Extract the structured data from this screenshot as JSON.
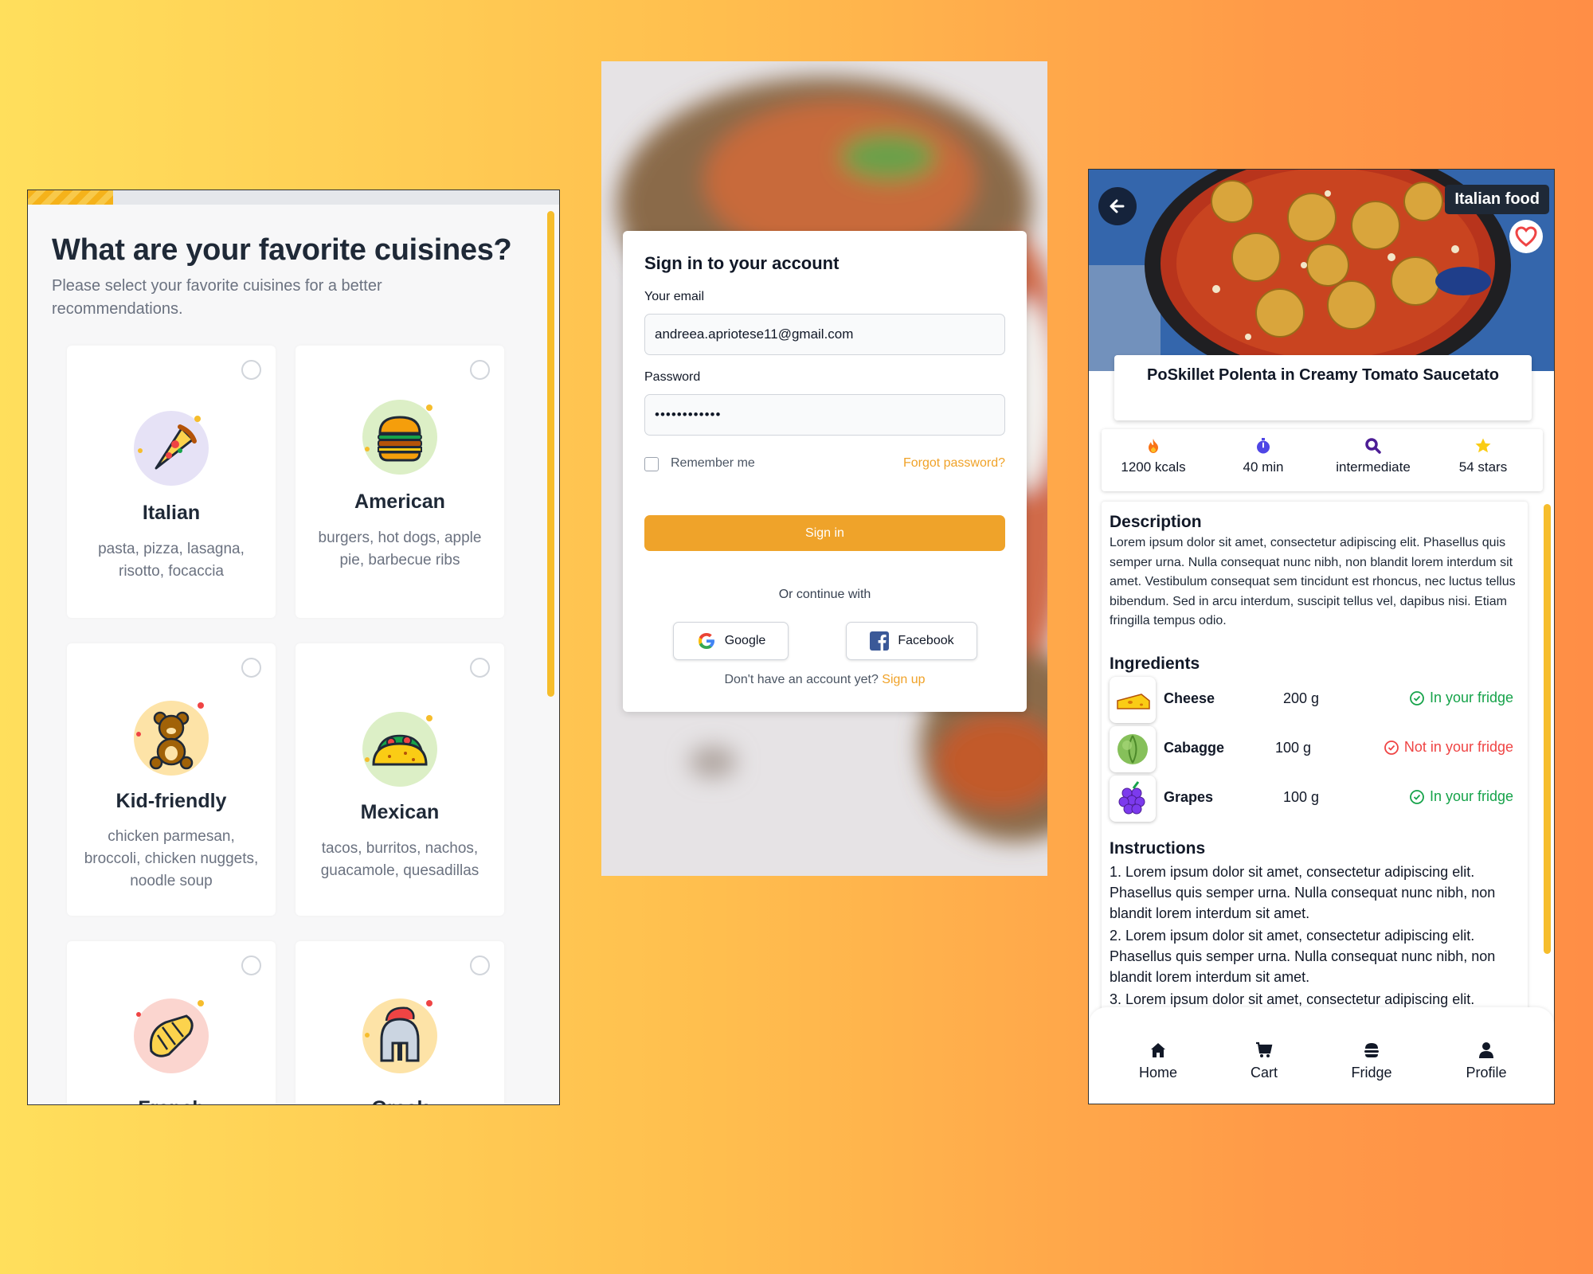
{
  "cuisine_screen": {
    "progress_fraction": 0.16,
    "title": "What are your favorite cuisines?",
    "subtitle": "Please select your favorite cuisines for a better recommendations.",
    "cards": [
      {
        "name": "Italian",
        "desc": "pasta, pizza, lasagna, risotto, focaccia",
        "icon": "pizza-icon"
      },
      {
        "name": "American",
        "desc": "burgers, hot dogs, apple pie, barbecue ribs",
        "icon": "burger-icon"
      },
      {
        "name": "Kid-friendly",
        "desc": "chicken parmesan, broccoli, chicken nuggets, noodle soup",
        "icon": "teddy-bear-icon"
      },
      {
        "name": "Mexican",
        "desc": "tacos, burritos, nachos, guacamole, quesadillas",
        "icon": "taco-icon"
      },
      {
        "name": "French",
        "desc": "",
        "icon": "croissant-icon"
      },
      {
        "name": "Greek",
        "desc": "",
        "icon": "helmet-icon"
      }
    ]
  },
  "signin_screen": {
    "title": "Sign in to your account",
    "email_label": "Your email",
    "email_value": "andreea.apriotese11@gmail.com",
    "password_label": "Password",
    "password_value": "••••••••••••",
    "remember_label": "Remember me",
    "forgot_label": "Forgot password?",
    "signin_button": "Sign in",
    "or_continue": "Or continue with",
    "google_label": "Google",
    "facebook_label": "Facebook",
    "no_account_text": "Don't have an account yet?",
    "signup_label": "Sign up"
  },
  "recipe_screen": {
    "tag": "Italian food",
    "title": "PoSkillet Polenta in Creamy Tomato Saucetato",
    "stats": [
      {
        "label": "1200 kcals",
        "icon": "flame-icon"
      },
      {
        "label": "40 min",
        "icon": "stopwatch-icon"
      },
      {
        "label": "intermediate",
        "icon": "magnifier-icon"
      },
      {
        "label": "54 stars",
        "icon": "star-icon"
      }
    ],
    "description_heading": "Description",
    "description_text": "Lorem ipsum dolor sit amet, consectetur adipiscing elit. Phasellus quis semper urna. Nulla consequat nunc nibh, non blandit lorem interdum sit amet. Vestibulum consequat sem tincidunt est rhoncus, nec luctus tellus bibendum. Sed in arcu interdum, suscipit tellus vel, dapibus nisi. Etiam fringilla tempus odio.",
    "ingredients_heading": "Ingredients",
    "ingredients": [
      {
        "name": "Cheese",
        "qty": "200 g",
        "status": "In your fridge",
        "in_fridge": true,
        "icon": "cheese-icon"
      },
      {
        "name": "Cabagge",
        "qty": "100 g",
        "status": "Not in your fridge",
        "in_fridge": false,
        "icon": "cabbage-icon"
      },
      {
        "name": "Grapes",
        "qty": "100 g",
        "status": "In your fridge",
        "in_fridge": true,
        "icon": "grapes-icon"
      }
    ],
    "instructions_heading": "Instructions",
    "instructions": [
      "1. Lorem ipsum dolor sit amet, consectetur adipiscing elit. Phasellus quis semper urna. Nulla consequat nunc nibh, non blandit lorem interdum sit amet.",
      "2. Lorem ipsum dolor sit amet, consectetur adipiscing elit. Phasellus quis semper urna. Nulla consequat nunc nibh, non blandit lorem interdum sit amet.",
      "3. Lorem ipsum dolor sit amet, consectetur adipiscing elit."
    ],
    "nav": [
      {
        "label": "Home",
        "icon": "home-icon"
      },
      {
        "label": "Cart",
        "icon": "cart-icon"
      },
      {
        "label": "Fridge",
        "icon": "fridge-icon"
      },
      {
        "label": "Profile",
        "icon": "profile-icon"
      }
    ]
  },
  "colors": {
    "accent": "#efa32a",
    "ok": "#16a34a",
    "error": "#ef4444",
    "dark_tag": "#1f2937"
  }
}
